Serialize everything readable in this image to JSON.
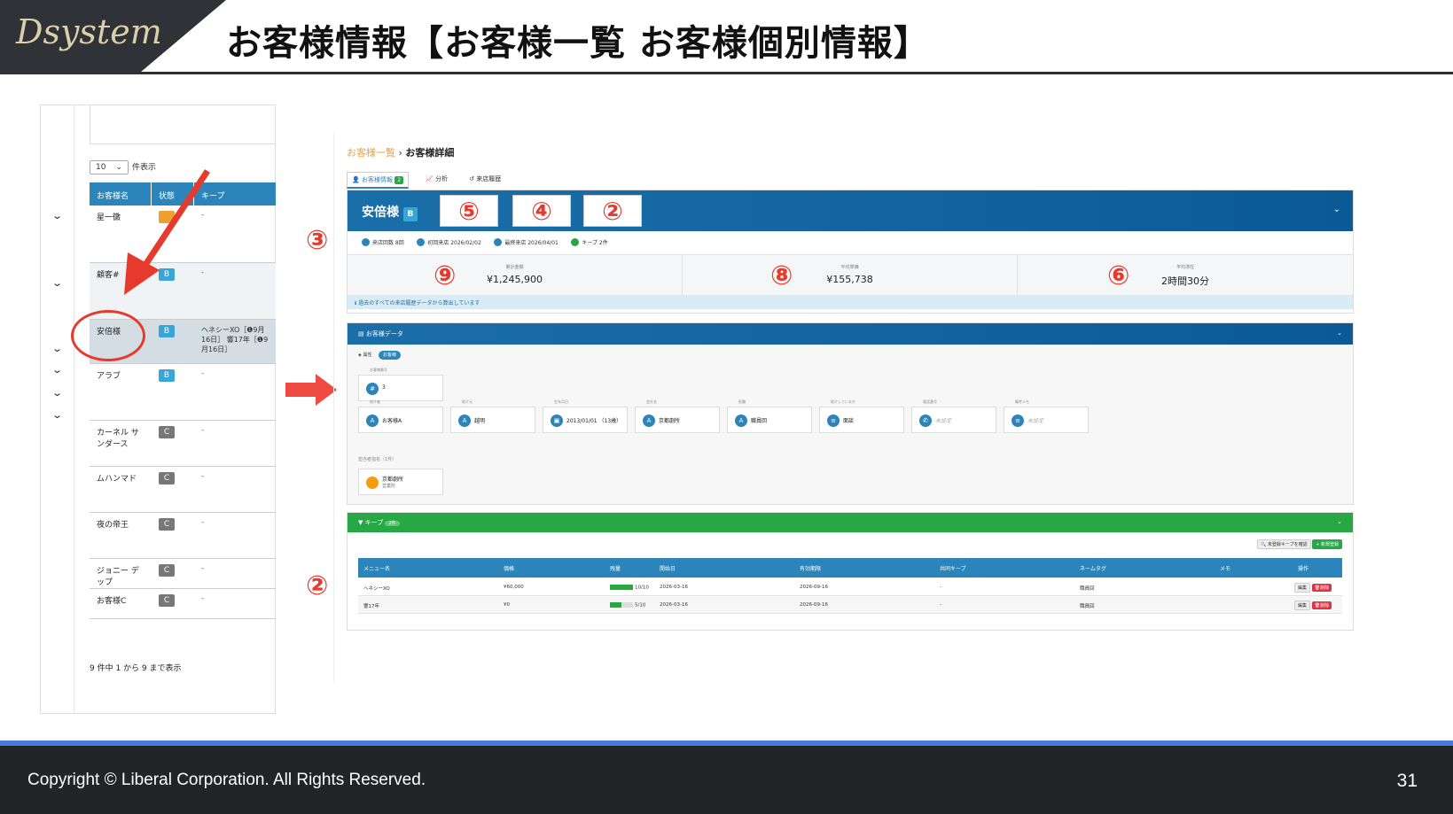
{
  "slide": {
    "title": "お客様情報【お客様一覧 お客様個別情報】",
    "logo_text": "Dsystem",
    "copyright": "Copyright ©  Liberal Corporation. All Rights Reserved.",
    "page_number": "31"
  },
  "list_panel": {
    "page_size": "10",
    "page_size_suffix": "件表示",
    "columns": [
      "お客様名",
      "状態",
      "キープ"
    ],
    "rows": [
      {
        "name": "星一黴",
        "status": "",
        "status_color": "#f0a030",
        "keep": "-"
      },
      {
        "name": "顧客#",
        "status": "B",
        "keep": "-"
      },
      {
        "name": "安倍様",
        "status": "B",
        "keep": "ヘネシーXO［❶9月16日］ 響17年［❶9月16日］"
      },
      {
        "name": "アラブ",
        "status": "B",
        "keep": "-"
      },
      {
        "name": "カーネル サンダース",
        "status": "C",
        "keep": "-"
      },
      {
        "name": "ムハンマド",
        "status": "C",
        "keep": "-"
      },
      {
        "name": "夜の帝王",
        "status": "C",
        "keep": "-"
      },
      {
        "name": "ジョニー デップ",
        "status": "C",
        "keep": "-"
      },
      {
        "name": "お客様C",
        "status": "C",
        "keep": "-"
      }
    ],
    "footer": "9 件中 1 から 9 まで表示",
    "dropdown_icon": "chevron-down-icon"
  },
  "detail_panel": {
    "breadcrumb": {
      "parent": "お客様一覧",
      "separator": "›",
      "current": "お客様詳細"
    },
    "tabs": [
      "お客様情報",
      "分析",
      "来店履歴"
    ],
    "tab_count": "2",
    "customer": {
      "name": "安倍様",
      "rank": "B"
    },
    "markers": {
      "m5": "⑤",
      "m4": "④",
      "m2a": "②",
      "m3": "③",
      "m9": "⑨",
      "m8": "⑧",
      "m6": "⑥",
      "m2b": "②"
    },
    "pills": [
      "来店回数 8回",
      "初回来店 2026/02/02",
      "最終来店 2026/04/01",
      "キープ 2件"
    ],
    "stats": [
      {
        "label": "累計金額",
        "value": "¥1,245,900"
      },
      {
        "label": "平均単価",
        "value": "¥155,738"
      },
      {
        "label": "平均滞在",
        "value": "2時間30分"
      }
    ],
    "info_note": "過去のすべての来店履歴データから算出しています",
    "data_section": {
      "header": "お客様データ",
      "subtabs": [
        "属性",
        "お客様"
      ],
      "number_label": "お客様番号",
      "number_value": "3",
      "fields": [
        {
          "label": "紹介者",
          "value": "お客様A",
          "icon": "A"
        },
        {
          "label": "紹介元",
          "value": "越明",
          "icon": "A"
        },
        {
          "label": "生年月日",
          "value": "2013/01/01 （13歳）",
          "icon": "▣"
        },
        {
          "label": "会社名",
          "value": "京都劇所",
          "icon": "A"
        },
        {
          "label": "役職",
          "value": "職員回",
          "icon": "A"
        },
        {
          "label": "紹介しているか",
          "value": "面談",
          "icon": "≡"
        },
        {
          "label": "電話番号",
          "value": "未設定",
          "icon": "✆"
        },
        {
          "label": "備考メモ",
          "value": "未設定",
          "icon": "≡"
        }
      ],
      "staff_label": "担当者指名（1件）",
      "staff_name": "京都劇所",
      "staff_sub": "営業所"
    },
    "keep_section": {
      "header": "キープ",
      "count": "2件",
      "btn_search": "未登録キープを確認",
      "btn_new": "新規登録",
      "columns": [
        "メニュー名",
        "価格",
        "残量",
        "開始日",
        "有効期限",
        "共同キープ",
        "ネームタグ",
        "メモ",
        "操作"
      ],
      "rows": [
        {
          "menu": "ヘネシーXO",
          "price": "¥60,000",
          "remain": "10/10",
          "remain_frac": 1.0,
          "start": "2026-03-16",
          "expire": "2026-09-16",
          "shared": "-",
          "tag": "職員回",
          "memo": "",
          "edit": "編集",
          "del": "削除"
        },
        {
          "menu": "響17年",
          "price": "¥0",
          "remain": "5/10",
          "remain_frac": 0.5,
          "start": "2026-03-16",
          "expire": "2026-09-16",
          "shared": "-",
          "tag": "職員回",
          "memo": "",
          "edit": "編集",
          "del": "削除"
        }
      ]
    }
  },
  "colors": {
    "accent": "#e63a2e",
    "header_blue": "#0b5a96",
    "green": "#28a745"
  }
}
